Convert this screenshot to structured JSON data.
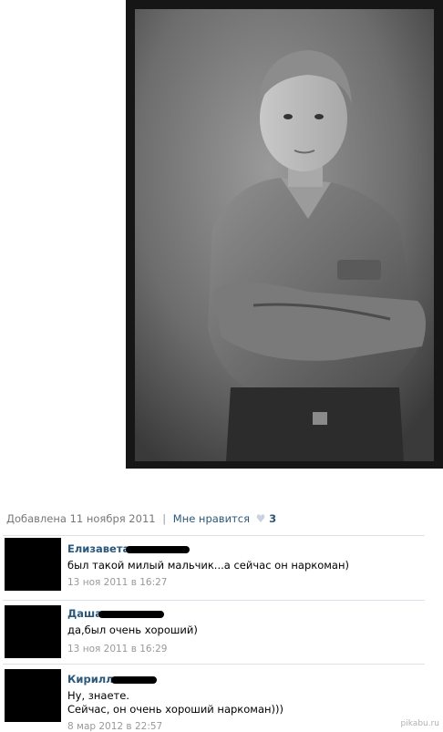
{
  "post": {
    "added_label": "Добавлена 11 ноября 2011",
    "separator": "|",
    "like_label": "Мне нравится",
    "like_count": "3"
  },
  "comments": [
    {
      "author": "Елизавета",
      "text": "был такой милый мальчик...а сейчас он наркоман)",
      "date": "13 ноя 2011 в 16:27"
    },
    {
      "author": "Даша",
      "text": "да,был очень хороший)",
      "date": "13 ноя 2011 в 16:29"
    },
    {
      "author": "Кирилл",
      "text": "Ну, знаете.\nСейчас, он очень хороший наркоман)))",
      "date": "8 мар 2012 в 22:57"
    }
  ],
  "watermark": "pikabu.ru",
  "icons": {
    "like": "heart-icon"
  },
  "colors": {
    "link": "#2b587a",
    "meta": "#777777",
    "date": "#999999",
    "divider": "#dae1e8"
  }
}
